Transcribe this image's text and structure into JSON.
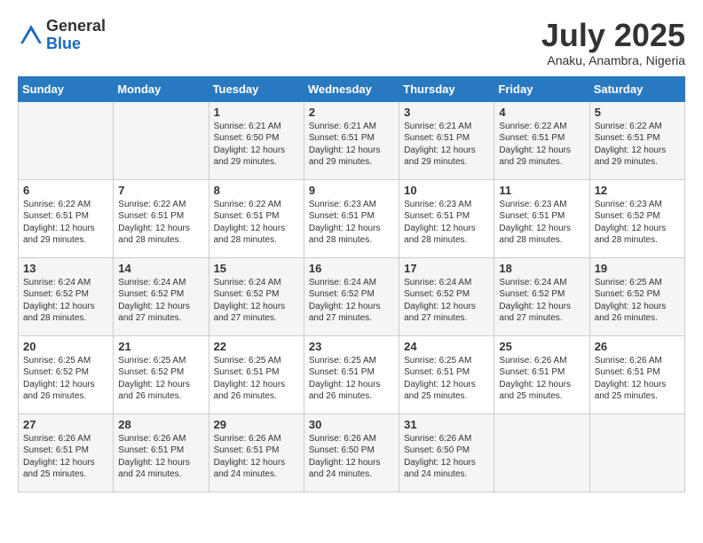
{
  "header": {
    "logo_general": "General",
    "logo_blue": "Blue",
    "month_title": "July 2025",
    "subtitle": "Anaku, Anambra, Nigeria"
  },
  "days_of_week": [
    "Sunday",
    "Monday",
    "Tuesday",
    "Wednesday",
    "Thursday",
    "Friday",
    "Saturday"
  ],
  "weeks": [
    [
      {
        "day": "",
        "sunrise": "",
        "sunset": "",
        "daylight": ""
      },
      {
        "day": "",
        "sunrise": "",
        "sunset": "",
        "daylight": ""
      },
      {
        "day": "1",
        "sunrise": "Sunrise: 6:21 AM",
        "sunset": "Sunset: 6:50 PM",
        "daylight": "Daylight: 12 hours and 29 minutes."
      },
      {
        "day": "2",
        "sunrise": "Sunrise: 6:21 AM",
        "sunset": "Sunset: 6:51 PM",
        "daylight": "Daylight: 12 hours and 29 minutes."
      },
      {
        "day": "3",
        "sunrise": "Sunrise: 6:21 AM",
        "sunset": "Sunset: 6:51 PM",
        "daylight": "Daylight: 12 hours and 29 minutes."
      },
      {
        "day": "4",
        "sunrise": "Sunrise: 6:22 AM",
        "sunset": "Sunset: 6:51 PM",
        "daylight": "Daylight: 12 hours and 29 minutes."
      },
      {
        "day": "5",
        "sunrise": "Sunrise: 6:22 AM",
        "sunset": "Sunset: 6:51 PM",
        "daylight": "Daylight: 12 hours and 29 minutes."
      }
    ],
    [
      {
        "day": "6",
        "sunrise": "Sunrise: 6:22 AM",
        "sunset": "Sunset: 6:51 PM",
        "daylight": "Daylight: 12 hours and 29 minutes."
      },
      {
        "day": "7",
        "sunrise": "Sunrise: 6:22 AM",
        "sunset": "Sunset: 6:51 PM",
        "daylight": "Daylight: 12 hours and 28 minutes."
      },
      {
        "day": "8",
        "sunrise": "Sunrise: 6:22 AM",
        "sunset": "Sunset: 6:51 PM",
        "daylight": "Daylight: 12 hours and 28 minutes."
      },
      {
        "day": "9",
        "sunrise": "Sunrise: 6:23 AM",
        "sunset": "Sunset: 6:51 PM",
        "daylight": "Daylight: 12 hours and 28 minutes."
      },
      {
        "day": "10",
        "sunrise": "Sunrise: 6:23 AM",
        "sunset": "Sunset: 6:51 PM",
        "daylight": "Daylight: 12 hours and 28 minutes."
      },
      {
        "day": "11",
        "sunrise": "Sunrise: 6:23 AM",
        "sunset": "Sunset: 6:51 PM",
        "daylight": "Daylight: 12 hours and 28 minutes."
      },
      {
        "day": "12",
        "sunrise": "Sunrise: 6:23 AM",
        "sunset": "Sunset: 6:52 PM",
        "daylight": "Daylight: 12 hours and 28 minutes."
      }
    ],
    [
      {
        "day": "13",
        "sunrise": "Sunrise: 6:24 AM",
        "sunset": "Sunset: 6:52 PM",
        "daylight": "Daylight: 12 hours and 28 minutes."
      },
      {
        "day": "14",
        "sunrise": "Sunrise: 6:24 AM",
        "sunset": "Sunset: 6:52 PM",
        "daylight": "Daylight: 12 hours and 27 minutes."
      },
      {
        "day": "15",
        "sunrise": "Sunrise: 6:24 AM",
        "sunset": "Sunset: 6:52 PM",
        "daylight": "Daylight: 12 hours and 27 minutes."
      },
      {
        "day": "16",
        "sunrise": "Sunrise: 6:24 AM",
        "sunset": "Sunset: 6:52 PM",
        "daylight": "Daylight: 12 hours and 27 minutes."
      },
      {
        "day": "17",
        "sunrise": "Sunrise: 6:24 AM",
        "sunset": "Sunset: 6:52 PM",
        "daylight": "Daylight: 12 hours and 27 minutes."
      },
      {
        "day": "18",
        "sunrise": "Sunrise: 6:24 AM",
        "sunset": "Sunset: 6:52 PM",
        "daylight": "Daylight: 12 hours and 27 minutes."
      },
      {
        "day": "19",
        "sunrise": "Sunrise: 6:25 AM",
        "sunset": "Sunset: 6:52 PM",
        "daylight": "Daylight: 12 hours and 26 minutes."
      }
    ],
    [
      {
        "day": "20",
        "sunrise": "Sunrise: 6:25 AM",
        "sunset": "Sunset: 6:52 PM",
        "daylight": "Daylight: 12 hours and 26 minutes."
      },
      {
        "day": "21",
        "sunrise": "Sunrise: 6:25 AM",
        "sunset": "Sunset: 6:52 PM",
        "daylight": "Daylight: 12 hours and 26 minutes."
      },
      {
        "day": "22",
        "sunrise": "Sunrise: 6:25 AM",
        "sunset": "Sunset: 6:51 PM",
        "daylight": "Daylight: 12 hours and 26 minutes."
      },
      {
        "day": "23",
        "sunrise": "Sunrise: 6:25 AM",
        "sunset": "Sunset: 6:51 PM",
        "daylight": "Daylight: 12 hours and 26 minutes."
      },
      {
        "day": "24",
        "sunrise": "Sunrise: 6:25 AM",
        "sunset": "Sunset: 6:51 PM",
        "daylight": "Daylight: 12 hours and 25 minutes."
      },
      {
        "day": "25",
        "sunrise": "Sunrise: 6:26 AM",
        "sunset": "Sunset: 6:51 PM",
        "daylight": "Daylight: 12 hours and 25 minutes."
      },
      {
        "day": "26",
        "sunrise": "Sunrise: 6:26 AM",
        "sunset": "Sunset: 6:51 PM",
        "daylight": "Daylight: 12 hours and 25 minutes."
      }
    ],
    [
      {
        "day": "27",
        "sunrise": "Sunrise: 6:26 AM",
        "sunset": "Sunset: 6:51 PM",
        "daylight": "Daylight: 12 hours and 25 minutes."
      },
      {
        "day": "28",
        "sunrise": "Sunrise: 6:26 AM",
        "sunset": "Sunset: 6:51 PM",
        "daylight": "Daylight: 12 hours and 24 minutes."
      },
      {
        "day": "29",
        "sunrise": "Sunrise: 6:26 AM",
        "sunset": "Sunset: 6:51 PM",
        "daylight": "Daylight: 12 hours and 24 minutes."
      },
      {
        "day": "30",
        "sunrise": "Sunrise: 6:26 AM",
        "sunset": "Sunset: 6:50 PM",
        "daylight": "Daylight: 12 hours and 24 minutes."
      },
      {
        "day": "31",
        "sunrise": "Sunrise: 6:26 AM",
        "sunset": "Sunset: 6:50 PM",
        "daylight": "Daylight: 12 hours and 24 minutes."
      },
      {
        "day": "",
        "sunrise": "",
        "sunset": "",
        "daylight": ""
      },
      {
        "day": "",
        "sunrise": "",
        "sunset": "",
        "daylight": ""
      }
    ]
  ]
}
